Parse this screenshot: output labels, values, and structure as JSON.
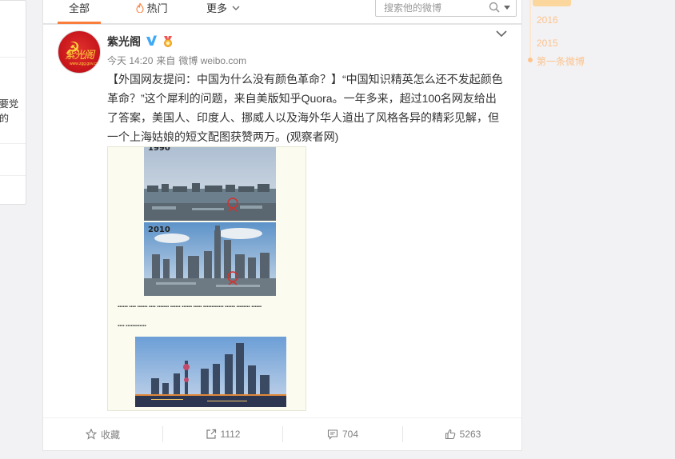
{
  "left_panel": {
    "snippet_1": "要党",
    "snippet_2": "的"
  },
  "tabs": [
    {
      "label": "全部"
    },
    {
      "label": "热门"
    },
    {
      "label": "更多"
    }
  ],
  "search": {
    "placeholder": "搜索他的微博"
  },
  "post": {
    "author": "紫光阁",
    "time": "今天 14:20",
    "source_prefix": "来自",
    "source": "微博 weibo.com",
    "text": "【外国网友提问：中国为什么没有颜色革命？】“中国知识精英怎么还不发起颜色革命？”这个犀利的问题，来自美版知乎Quora。一年多来，超过100名网友给出了答案，美国人、印度人、挪威人以及海外华人道出了风格各异的精彩见解，但一个上海姑娘的短文配图获赞两万。(观察者网)",
    "image": {
      "year_top": "1990",
      "year_mid": "2010"
    },
    "actions": {
      "favorite": "收藏",
      "repost": "1112",
      "comment": "704",
      "like": "5263"
    }
  },
  "timeline": {
    "years": [
      "2016",
      "2015"
    ],
    "first_post": "第一条微博"
  },
  "colors": {
    "accent": "#fa7d3c",
    "timeline": "#fcc38c",
    "verified": "#3fa9f5"
  }
}
